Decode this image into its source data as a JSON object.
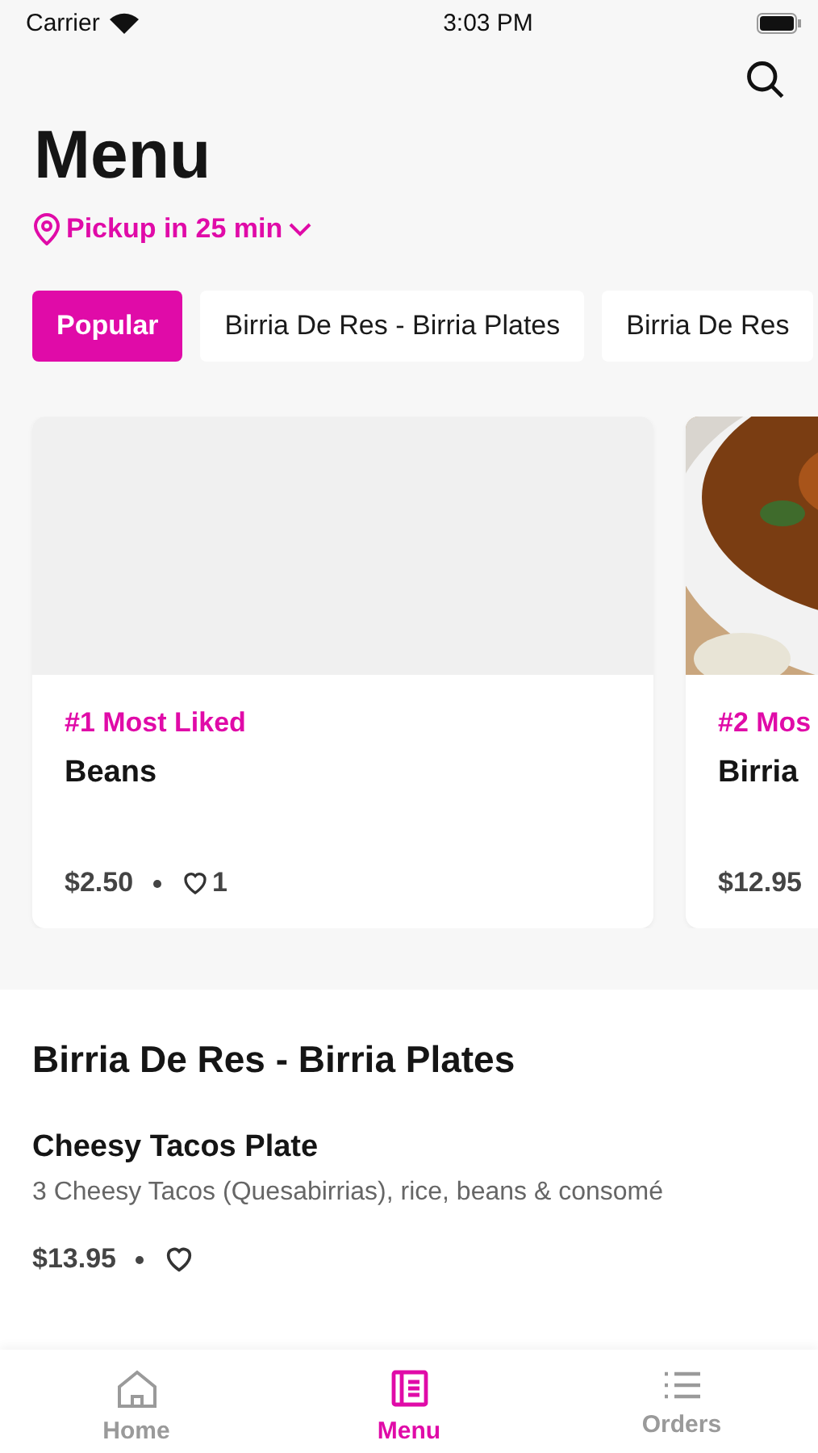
{
  "status_bar": {
    "carrier": "Carrier",
    "time": "3:03 PM"
  },
  "title": "Menu",
  "pickup": "Pickup in 25 min",
  "chips": [
    {
      "label": "Popular",
      "selected": true
    },
    {
      "label": "Birria De Res - Birria Plates",
      "selected": false
    },
    {
      "label": "Birria De Res",
      "selected": false
    }
  ],
  "cards": [
    {
      "kind": "placeholder",
      "rank": "#1 Most Liked",
      "name": "Beans",
      "price": "$2.50",
      "likes": "1"
    },
    {
      "kind": "picture",
      "rank": "#2 Mos",
      "name": "Birria",
      "price": "$12.95"
    }
  ],
  "section": {
    "title": "Birria De Res - Birria Plates",
    "items": [
      {
        "name": "Cheesy Tacos Plate",
        "description": "3 Cheesy Tacos (Quesabirrias), rice, beans & consomé",
        "price": "$13.95"
      }
    ]
  },
  "tabs": [
    {
      "kind": "home",
      "label": "Home",
      "selected": false
    },
    {
      "kind": "menu",
      "label": "Menu",
      "selected": true
    },
    {
      "kind": "orders",
      "label": "Orders",
      "selected": false
    }
  ]
}
